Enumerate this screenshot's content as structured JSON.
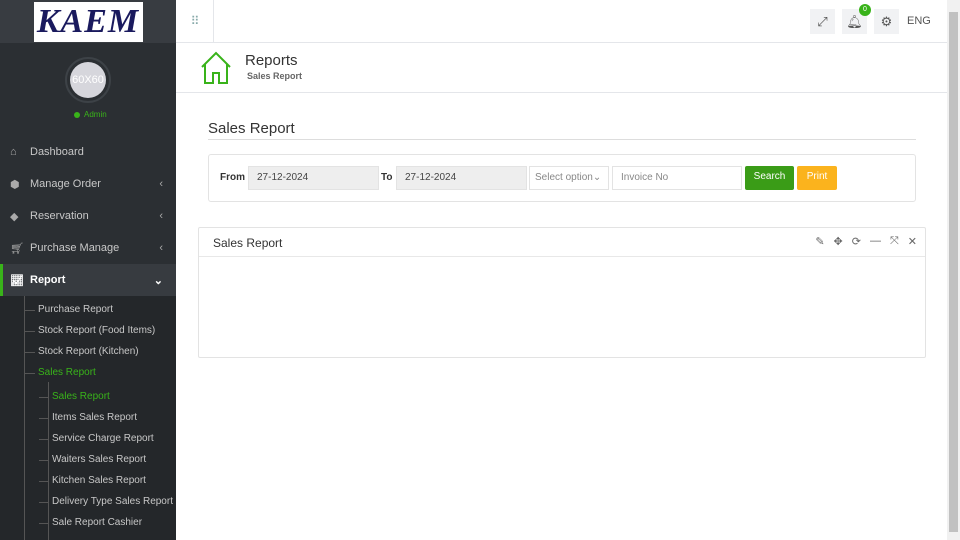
{
  "logo": "KAEM",
  "user": {
    "avatar": "60X60",
    "role": "Admin"
  },
  "nav": [
    {
      "label": "Dashboard",
      "icon": "home-icon"
    },
    {
      "label": "Manage Order",
      "icon": "cube-icon"
    },
    {
      "label": "Reservation",
      "icon": "tag-icon"
    },
    {
      "label": "Purchase Manage",
      "icon": "cart-icon"
    },
    {
      "label": "Report",
      "icon": "chart-icon"
    }
  ],
  "report_sub": [
    "Purchase Report",
    "Stock Report (Food Items)",
    "Stock Report (Kitchen)",
    "Sales Report"
  ],
  "sales_sub": [
    "Sales Report",
    "Items Sales Report",
    "Service Charge Report",
    "Waiters Sales Report",
    "Kitchen Sales Report",
    "Delivery Type Sales Report",
    "Sale Report Cashier"
  ],
  "topbar": {
    "notif_count": "0",
    "lang": "ENG"
  },
  "header": {
    "title": "Reports",
    "subtitle": "Sales Report"
  },
  "page_title": "Sales Report",
  "filter": {
    "from_label": "From",
    "from": "27-12-2024",
    "to_label": "To",
    "to": "27-12-2024",
    "select": "Select option",
    "invoice_placeholder": "Invoice No",
    "search": "Search",
    "print": "Print"
  },
  "panel": {
    "title": "Sales Report"
  },
  "colors": {
    "accent": "#39b31a",
    "print": "#fbb31d"
  }
}
